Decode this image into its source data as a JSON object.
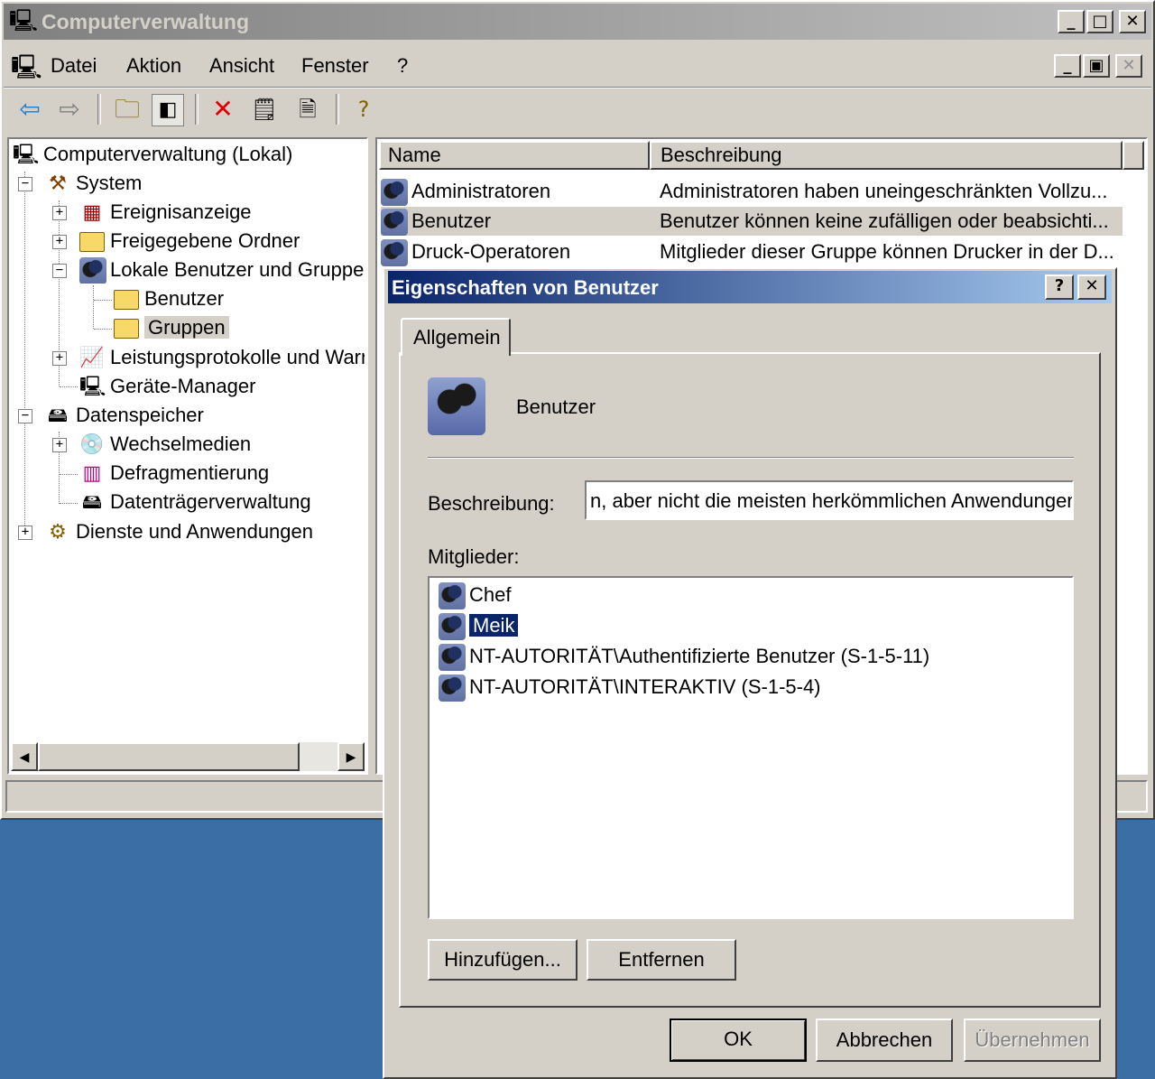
{
  "main_window": {
    "title": "Computerverwaltung",
    "menu": [
      {
        "label": "Datei",
        "accel": "D"
      },
      {
        "label": "Aktion",
        "accel": "k"
      },
      {
        "label": "Ansicht",
        "accel": "A"
      },
      {
        "label": "Fenster",
        "accel": "F"
      },
      {
        "label": "?",
        "accel": "?"
      }
    ],
    "toolbar_icons": [
      "back-arrow-icon",
      "forward-arrow-icon",
      "up-folder-icon",
      "show-hide-tree-icon",
      "delete-icon",
      "properties-icon",
      "export-list-icon",
      "help-icon"
    ]
  },
  "tree": {
    "root": "Computerverwaltung (Lokal)",
    "system": "System",
    "ereignisanzeige": "Ereignisanzeige",
    "freigegebene": "Freigegebene Ordner",
    "lokale": "Lokale Benutzer und Gruppen",
    "benutzer": "Benutzer",
    "gruppen": "Gruppen",
    "leistung": "Leistungsprotokolle und Warnungen",
    "geraete": "Geräte-Manager",
    "datenspeicher": "Datenspeicher",
    "wechselmedien": "Wechselmedien",
    "defrag": "Defragmentierung",
    "datentraeger": "Datenträgerverwaltung",
    "dienste": "Dienste und Anwendungen"
  },
  "list": {
    "col_name": "Name",
    "col_desc": "Beschreibung",
    "rows": [
      {
        "name": "Administratoren",
        "desc": "Administratoren haben uneingeschränkten Vollzu..."
      },
      {
        "name": "Benutzer",
        "desc": "Benutzer können keine zufälligen oder beabsichti..."
      },
      {
        "name": "Druck-Operatoren",
        "desc": "Mitglieder dieser Gruppe können Drucker in der D..."
      }
    ]
  },
  "dialog": {
    "title": "Eigenschaften von Benutzer",
    "help_btn": "?",
    "close_btn": "✕",
    "tab": "Allgemein",
    "group_name": "Benutzer",
    "desc_label": "Beschreibung:",
    "desc_value": "n, aber nicht die meisten herkömmlichen Anwendungen.",
    "members_label": "Mitglieder:",
    "members": [
      {
        "name": "Chef",
        "selected": false
      },
      {
        "name": "Meik",
        "selected": true
      },
      {
        "name": "NT-AUTORITÄT\\Authentifizierte Benutzer (S-1-5-11)",
        "selected": false
      },
      {
        "name": "NT-AUTORITÄT\\INTERAKTIV (S-1-5-4)",
        "selected": false
      }
    ],
    "add_btn": "Hinzufügen...",
    "remove_btn": "Entfernen",
    "ok_btn": "OK",
    "cancel_btn": "Abbrechen",
    "apply_btn": "Übernehmen"
  },
  "colors": {
    "desktop": "#3a6ea5",
    "face": "#d4d0c8",
    "title_active_start": "#0a246a",
    "title_active_end": "#a6caf0",
    "title_inactive": "#808080",
    "selection": "#0a246a"
  }
}
